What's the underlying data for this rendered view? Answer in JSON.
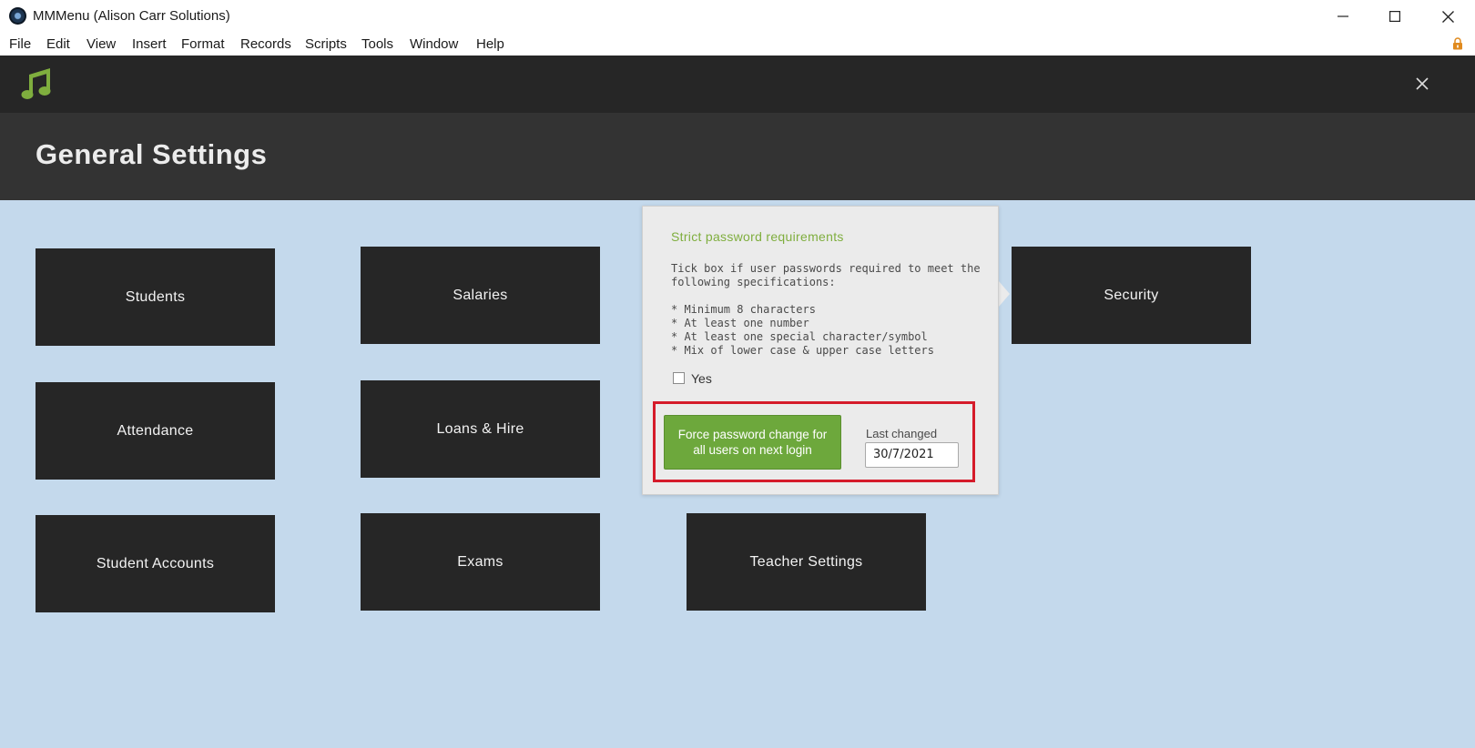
{
  "window": {
    "title": "MMMenu (Alison Carr Solutions)",
    "app_icon": "filemaker-app-icon",
    "controls": [
      "minimize-icon",
      "maximize-icon",
      "close-icon"
    ]
  },
  "menubar": {
    "items": [
      "File",
      "Edit",
      "View",
      "Insert",
      "Format",
      "Records",
      "Scripts",
      "Tools",
      "Window",
      "Help"
    ]
  },
  "header": {
    "logo_icon": "music-note-icon",
    "logo_color": "#7fae3e",
    "title": "General Settings",
    "close_icon": "close-icon"
  },
  "tiles": {
    "students": "Students",
    "salaries": "Salaries",
    "security": "Security",
    "attendance": "Attendance",
    "loans_hire": "Loans & Hire",
    "student_accounts": "Student Accounts",
    "exams": "Exams",
    "teacher_settings": "Teacher Settings"
  },
  "popover": {
    "heading": "Strict password requirements",
    "description": "Tick box if user passwords required to meet the\nfollowing specifications:",
    "requirements": "* Minimum 8 characters\n* At least one number\n* At least one special character/symbol\n* Mix of lower case & upper case letters",
    "checkbox_label": "Yes",
    "checkbox_checked": false,
    "force_button_label": "Force password change for all users on next login",
    "last_changed_label": "Last changed",
    "last_changed_value": "30/7/2021",
    "highlight_color": "#d51b2a",
    "button_color": "#6da83c"
  },
  "colors": {
    "header_dark": "#262626",
    "title_band": "#333333",
    "content_bg": "#c4d9ec",
    "tile_bg": "#262626"
  }
}
